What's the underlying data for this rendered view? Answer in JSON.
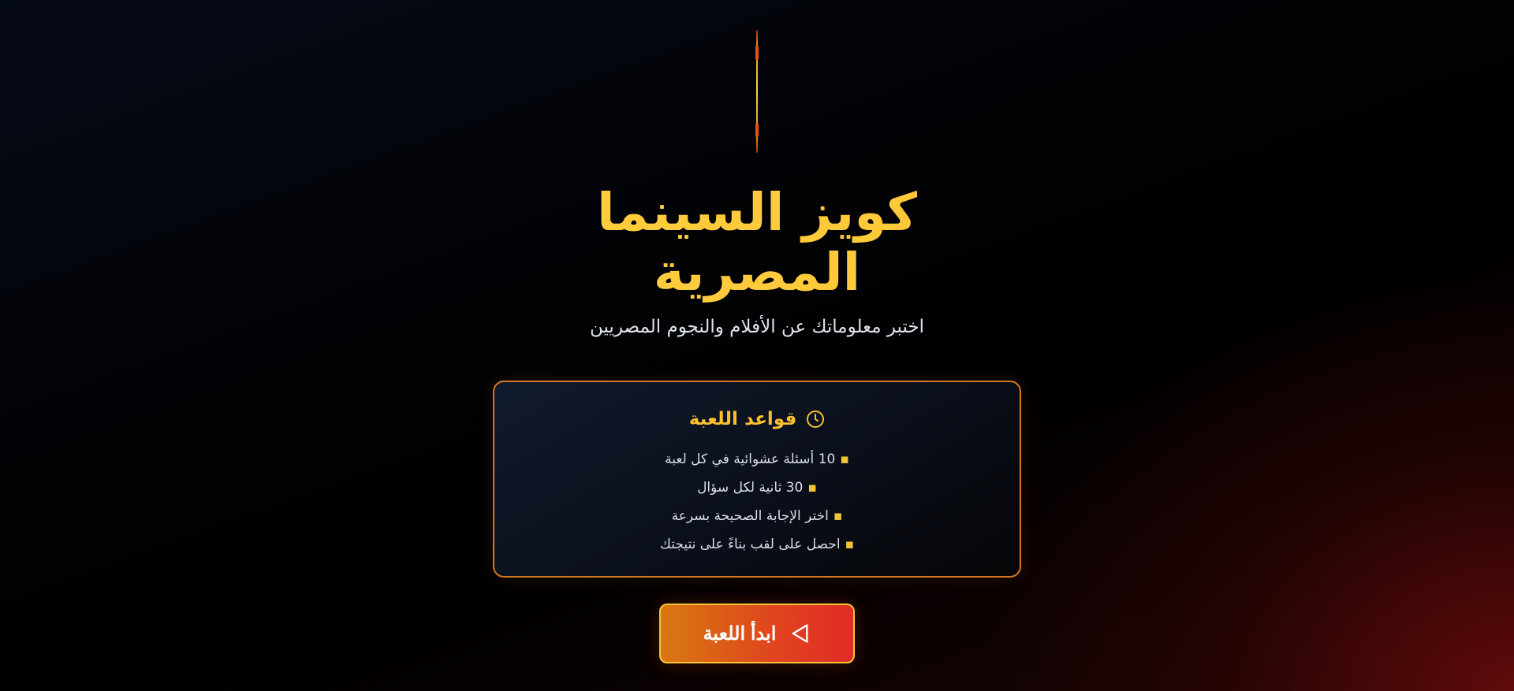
{
  "hero": {
    "title_line1": "كويز السينما",
    "title_line2": "المصرية",
    "subtitle": "اختبر معلوماتك عن الأفلام والنجوم المصريين"
  },
  "rules": {
    "title": "قواعد اللعبة",
    "icon": "clock-icon",
    "items": [
      "10 أسئلة عشوائية في كل لعبة",
      "30 ثانية لكل سؤال",
      "اختر الإجابة الصحيحة بسرعة",
      "احصل على لقب بناءً على نتيجتك"
    ]
  },
  "start_button": {
    "label": "ابدأ اللعبة",
    "icon": "play-icon"
  },
  "colors": {
    "accent_gold": "#f9bf2e",
    "accent_orange": "#d4781f",
    "button_red": "#e02c26"
  }
}
